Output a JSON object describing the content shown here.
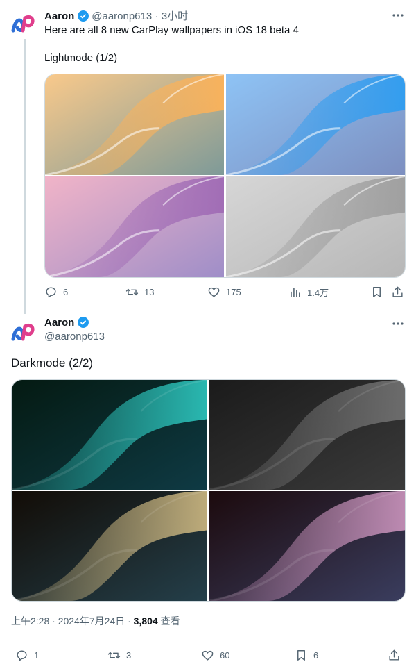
{
  "tweet1": {
    "author_name": "Aaron",
    "handle": "@aaronp613",
    "time": "· 3小时",
    "text": "Here are all 8 new CarPlay wallpapers in iOS 18 beta 4",
    "subtitle": "Lightmode (1/2)",
    "actions": {
      "replies": "6",
      "retweets": "13",
      "likes": "175",
      "views": "1.4万"
    },
    "wallpapers": [
      {
        "name": "orange",
        "base": "#f9c98b",
        "accent": "#fbb25a",
        "shade": "#7e9a98"
      },
      {
        "name": "blue",
        "base": "#8ec3f5",
        "accent": "#2f9df0",
        "shade": "#7d8fc0"
      },
      {
        "name": "pink-purple",
        "base": "#f1b4c8",
        "accent": "#a06bb5",
        "shade": "#9f8ec8"
      },
      {
        "name": "gray",
        "base": "#d6d6d6",
        "accent": "#9e9e9e",
        "shade": "#b7b7b7"
      }
    ]
  },
  "tweet2": {
    "author_name": "Aaron",
    "handle": "@aaronp613",
    "text": "Darkmode (2/2)",
    "timestamp": "上午2:28 · 2024年7月24日 · ",
    "views_count": "3,804",
    "views_label": " 查看",
    "actions": {
      "replies": "1",
      "retweets": "3",
      "likes": "60",
      "bookmarks": "6"
    },
    "wallpapers": [
      {
        "name": "dark-teal",
        "base": "#041a12",
        "accent": "#2bbfb7",
        "shade": "#0f3a44"
      },
      {
        "name": "dark-gray",
        "base": "#1b1b1b",
        "accent": "#6f6f6f",
        "shade": "#3a3a3a"
      },
      {
        "name": "dark-gold",
        "base": "#120c06",
        "accent": "#c6b27e",
        "shade": "#243f4a"
      },
      {
        "name": "dark-red",
        "base": "#1c0a0d",
        "accent": "#c48fb7",
        "shade": "#3a3d5e"
      }
    ]
  },
  "colors": {
    "verified": "#1d9bf0",
    "text": "#0f1419",
    "muted": "#536471"
  }
}
